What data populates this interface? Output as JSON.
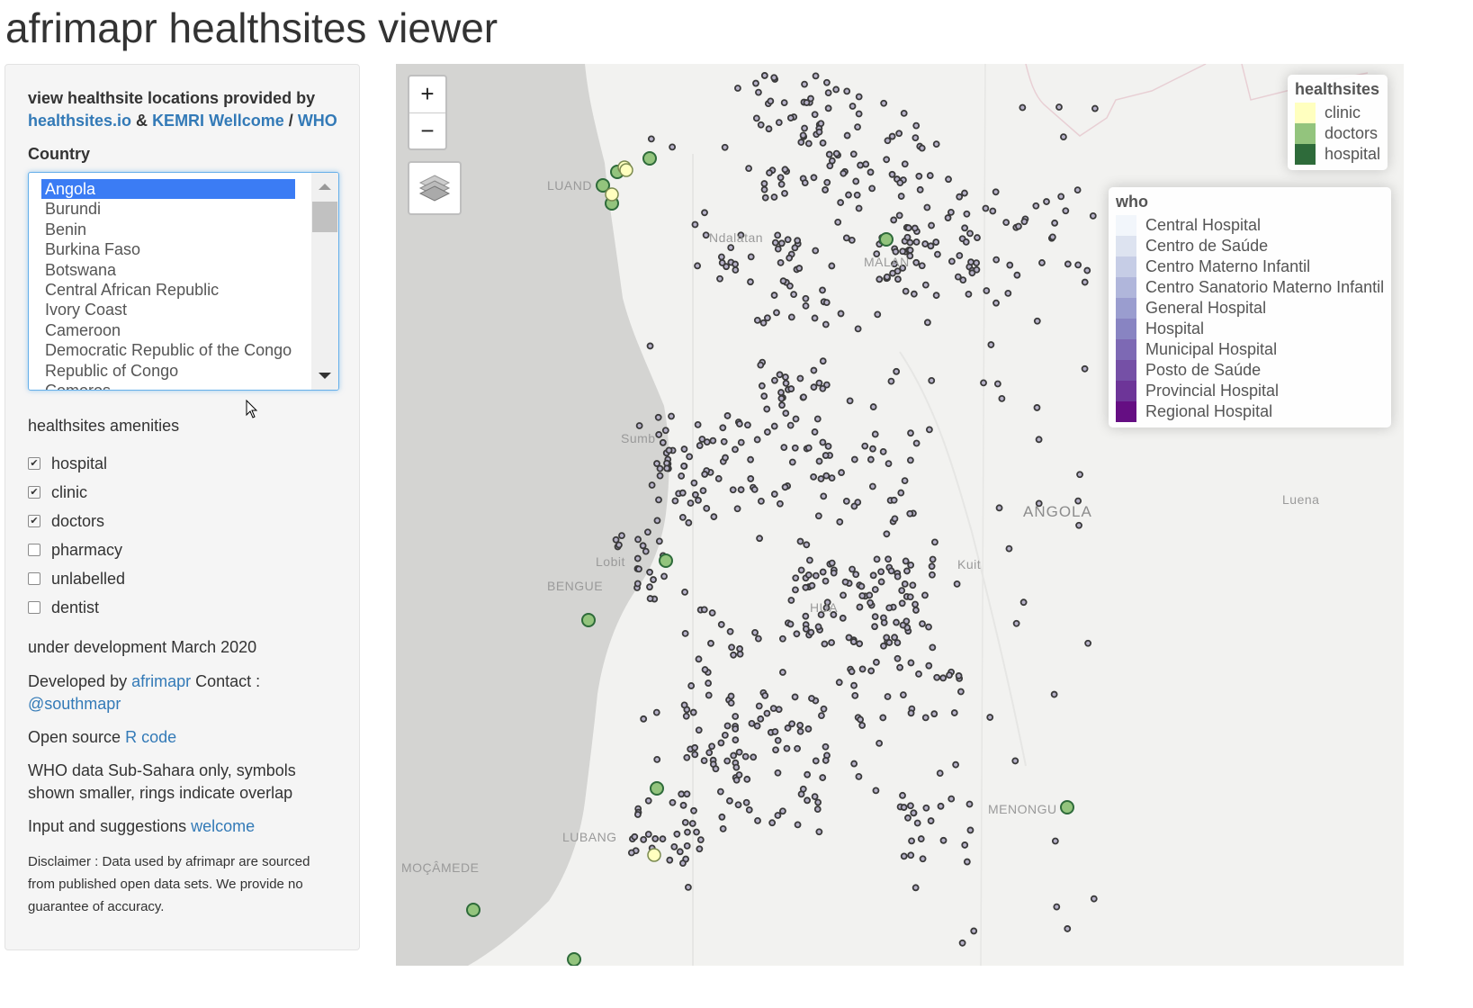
{
  "page": {
    "title": "afrimapr healthsites viewer"
  },
  "sidebar": {
    "heading_prefix": "view healthsite locations provided by",
    "link_healthsites": "healthsites.io",
    "amp": "&",
    "link_kemri": "KEMRI Wellcome",
    "slash": "/",
    "link_who": "WHO",
    "country_label": "Country",
    "countries": [
      "Angola",
      "Burundi",
      "Benin",
      "Burkina Faso",
      "Botswana",
      "Central African Republic",
      "Ivory Coast",
      "Cameroon",
      "Democratic Republic of the Congo",
      "Republic of Congo",
      "Comoros"
    ],
    "selected_country": "Angola",
    "amenities_label": "healthsites amenities",
    "amenities": [
      {
        "label": "hospital",
        "checked": true
      },
      {
        "label": "clinic",
        "checked": true
      },
      {
        "label": "doctors",
        "checked": true
      },
      {
        "label": "pharmacy",
        "checked": false
      },
      {
        "label": "unlabelled",
        "checked": false
      },
      {
        "label": "dentist",
        "checked": false
      }
    ],
    "dev_note": "under development March 2020",
    "developed_by": "Developed by",
    "afrimapr_link": "afrimapr",
    "contact": "Contact :",
    "southmapr_link": "@southmapr",
    "open_source": "Open source",
    "rcode_link": "R code",
    "who_note": "WHO data Sub-Sahara only, symbols shown smaller, rings indicate overlap",
    "input_prefix": "Input and suggestions",
    "welcome_link": "welcome",
    "disclaimer": "Disclaimer : Data used by afrimapr are sourced from published open data sets. We provide no guarantee of accuracy."
  },
  "map": {
    "zoom_in": "+",
    "zoom_out": "−",
    "layers_icon": "layers-icon",
    "places": [
      {
        "name": "LUAND",
        "kind": "city"
      },
      {
        "name": "Ndalatan",
        "kind": "city"
      },
      {
        "name": "MALAN",
        "kind": "city"
      },
      {
        "name": "Sumb",
        "kind": "city"
      },
      {
        "name": "Lobit",
        "kind": "city"
      },
      {
        "name": "BENGUE",
        "kind": "city"
      },
      {
        "name": "HUA",
        "kind": "city"
      },
      {
        "name": "Kuit",
        "kind": "city"
      },
      {
        "name": "ANGOLA",
        "kind": "country"
      },
      {
        "name": "Luena",
        "kind": "city"
      },
      {
        "name": "MENONGU",
        "kind": "city"
      },
      {
        "name": "LUBANG",
        "kind": "city"
      },
      {
        "name": "MOÇÂMEDE",
        "kind": "city"
      }
    ],
    "legend_healthsites": {
      "title": "healthsites",
      "items": [
        {
          "label": "clinic",
          "color": "#ffffbf"
        },
        {
          "label": "doctors",
          "color": "#93c47d"
        },
        {
          "label": "hospital",
          "color": "#2e6b3a"
        }
      ]
    },
    "legend_who": {
      "title": "who",
      "items": [
        {
          "label": "Central Hospital",
          "color": "#f2f6fb"
        },
        {
          "label": "Centro de Saúde",
          "color": "#dde3f0"
        },
        {
          "label": "Centro Materno Infantil",
          "color": "#c6cde6"
        },
        {
          "label": "Centro Sanatorio Materno Infantil",
          "color": "#b0b6db"
        },
        {
          "label": "General Hospital",
          "color": "#9a9dcf"
        },
        {
          "label": "Hospital",
          "color": "#8884c2"
        },
        {
          "label": "Municipal Hospital",
          "color": "#7d69b4"
        },
        {
          "label": "Posto de Saúde",
          "color": "#7550a6"
        },
        {
          "label": "Provincial Hospital",
          "color": "#6d3598"
        },
        {
          "label": "Regional Hospital",
          "color": "#650e83"
        }
      ]
    }
  }
}
